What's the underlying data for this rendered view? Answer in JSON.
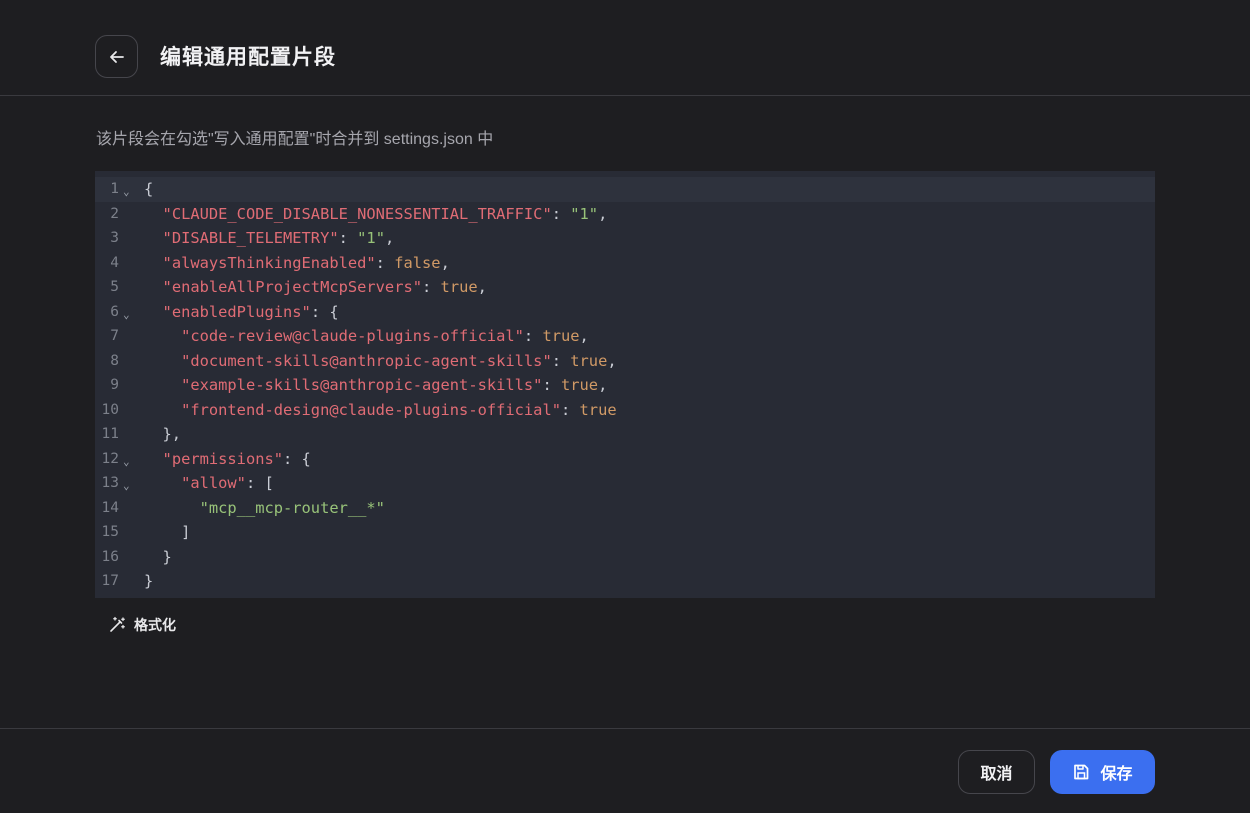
{
  "header": {
    "title": "编辑通用配置片段",
    "back_icon": "arrow-left-icon"
  },
  "description": "该片段会在勾选\"写入通用配置\"时合并到 settings.json 中",
  "editor": {
    "lines": [
      {
        "n": "1",
        "fold": true,
        "tokens": [
          [
            "p",
            "{"
          ]
        ]
      },
      {
        "n": "2",
        "fold": false,
        "tokens": [
          [
            "p",
            "  "
          ],
          [
            "k",
            "\"CLAUDE_CODE_DISABLE_NONESSENTIAL_TRAFFIC\""
          ],
          [
            "p",
            ": "
          ],
          [
            "s",
            "\"1\""
          ],
          [
            "p",
            ","
          ]
        ]
      },
      {
        "n": "3",
        "fold": false,
        "tokens": [
          [
            "p",
            "  "
          ],
          [
            "k",
            "\"DISABLE_TELEMETRY\""
          ],
          [
            "p",
            ": "
          ],
          [
            "s",
            "\"1\""
          ],
          [
            "p",
            ","
          ]
        ]
      },
      {
        "n": "4",
        "fold": false,
        "tokens": [
          [
            "p",
            "  "
          ],
          [
            "k",
            "\"alwaysThinkingEnabled\""
          ],
          [
            "p",
            ": "
          ],
          [
            "b",
            "false"
          ],
          [
            "p",
            ","
          ]
        ]
      },
      {
        "n": "5",
        "fold": false,
        "tokens": [
          [
            "p",
            "  "
          ],
          [
            "k",
            "\"enableAllProjectMcpServers\""
          ],
          [
            "p",
            ": "
          ],
          [
            "b",
            "true"
          ],
          [
            "p",
            ","
          ]
        ]
      },
      {
        "n": "6",
        "fold": true,
        "tokens": [
          [
            "p",
            "  "
          ],
          [
            "k",
            "\"enabledPlugins\""
          ],
          [
            "p",
            ": {"
          ]
        ]
      },
      {
        "n": "7",
        "fold": false,
        "tokens": [
          [
            "p",
            "    "
          ],
          [
            "k",
            "\"code-review@claude-plugins-official\""
          ],
          [
            "p",
            ": "
          ],
          [
            "b",
            "true"
          ],
          [
            "p",
            ","
          ]
        ]
      },
      {
        "n": "8",
        "fold": false,
        "tokens": [
          [
            "p",
            "    "
          ],
          [
            "k",
            "\"document-skills@anthropic-agent-skills\""
          ],
          [
            "p",
            ": "
          ],
          [
            "b",
            "true"
          ],
          [
            "p",
            ","
          ]
        ]
      },
      {
        "n": "9",
        "fold": false,
        "tokens": [
          [
            "p",
            "    "
          ],
          [
            "k",
            "\"example-skills@anthropic-agent-skills\""
          ],
          [
            "p",
            ": "
          ],
          [
            "b",
            "true"
          ],
          [
            "p",
            ","
          ]
        ]
      },
      {
        "n": "10",
        "fold": false,
        "tokens": [
          [
            "p",
            "    "
          ],
          [
            "k",
            "\"frontend-design@claude-plugins-official\""
          ],
          [
            "p",
            ": "
          ],
          [
            "b",
            "true"
          ]
        ]
      },
      {
        "n": "11",
        "fold": false,
        "tokens": [
          [
            "p",
            "  },"
          ]
        ]
      },
      {
        "n": "12",
        "fold": true,
        "tokens": [
          [
            "p",
            "  "
          ],
          [
            "k",
            "\"permissions\""
          ],
          [
            "p",
            ": {"
          ]
        ]
      },
      {
        "n": "13",
        "fold": true,
        "tokens": [
          [
            "p",
            "    "
          ],
          [
            "k",
            "\"allow\""
          ],
          [
            "p",
            ": ["
          ]
        ]
      },
      {
        "n": "14",
        "fold": false,
        "tokens": [
          [
            "p",
            "      "
          ],
          [
            "s",
            "\"mcp__mcp-router__*\""
          ]
        ]
      },
      {
        "n": "15",
        "fold": false,
        "tokens": [
          [
            "p",
            "    ]"
          ]
        ]
      },
      {
        "n": "16",
        "fold": false,
        "tokens": [
          [
            "p",
            "  }"
          ]
        ]
      },
      {
        "n": "17",
        "fold": false,
        "tokens": [
          [
            "p",
            "}"
          ]
        ]
      }
    ]
  },
  "format_button": {
    "label": "格式化",
    "icon": "magic-wand-icon"
  },
  "footer": {
    "cancel_label": "取消",
    "save_label": "保存",
    "save_icon": "floppy-disk-icon"
  },
  "colors": {
    "background": "#1e1e21",
    "editor_bg": "#282b35",
    "key": "#e06c75",
    "string": "#98c379",
    "boolean": "#d19a66",
    "primary": "#3b6ff0"
  }
}
